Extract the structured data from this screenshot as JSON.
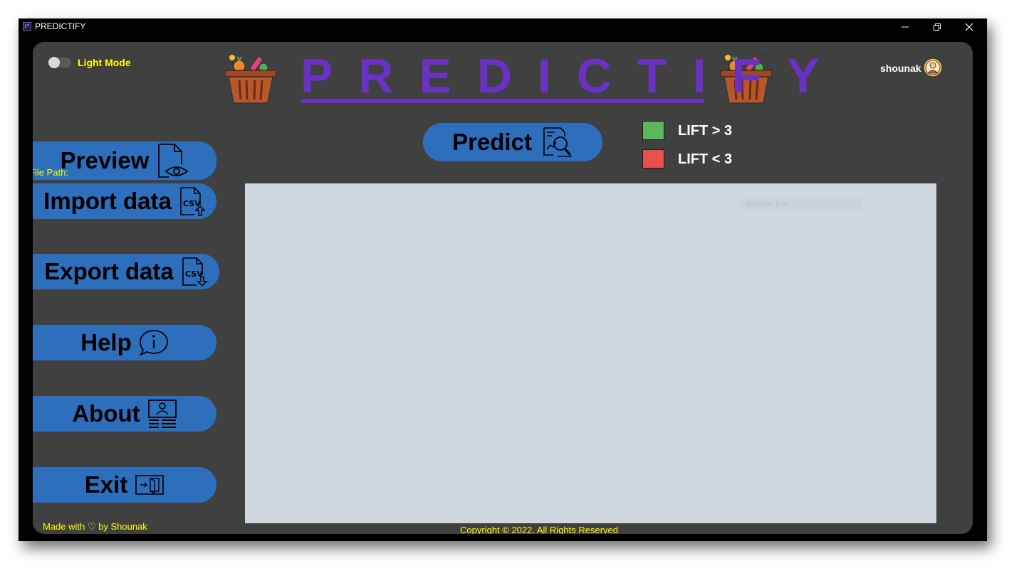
{
  "window": {
    "title": "PREDICTIFY",
    "controls": {
      "minimize_icon": "minimize-icon",
      "restore_icon": "restore-icon",
      "close_icon": "close-icon"
    }
  },
  "header": {
    "theme_toggle_label": "Light Mode",
    "theme_toggle_on": false,
    "logo_text": "PREDICTIFY",
    "username": "shounak",
    "avatar_icon": "user-avatar-icon",
    "basket_icon": "grocery-basket-icon"
  },
  "sidebar": {
    "file_path_label": "File Path:",
    "buttons": [
      {
        "label": "Preview",
        "icon": "document-eye-icon"
      },
      {
        "label": "Import data",
        "icon": "csv-upload-icon"
      },
      {
        "label": "Export data",
        "icon": "csv-download-icon"
      },
      {
        "label": "Help",
        "icon": "info-bubble-icon"
      },
      {
        "label": "About",
        "icon": "profile-card-icon"
      },
      {
        "label": "Exit",
        "icon": "exit-door-icon"
      }
    ],
    "footer": "Made with ♡ by Shounak"
  },
  "main": {
    "predict_label": "Predict",
    "predict_icon": "report-search-icon",
    "legend": [
      {
        "label": "LIFT > 3",
        "color": "#5cb85c"
      },
      {
        "label": "LIFT < 3",
        "color": "#e8504a"
      }
    ],
    "canvas_ghost_text": "Window first",
    "copyright": "Copyright © 2022. All Rights Reserved"
  },
  "colors": {
    "accent_purple": "#6a32c4",
    "button_blue": "#2e6fbd",
    "panel_bg": "#404040",
    "canvas_bg": "#d0d7df",
    "text_yellow": "#ffff00"
  }
}
